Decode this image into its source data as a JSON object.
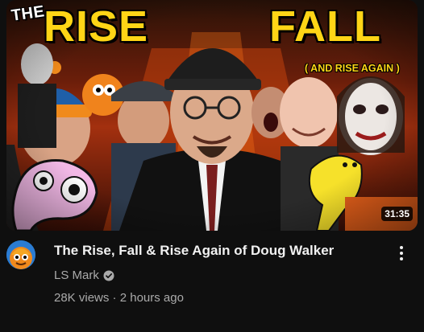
{
  "thumbnail": {
    "word_the": "THE",
    "word_rise": "RISE",
    "word_fall": "FALL",
    "word_again": "( AND RISE AGAIN )",
    "duration": "31:35"
  },
  "video": {
    "title": "The Rise, Fall & Rise Again of Doug Walker",
    "channel": "LS Mark",
    "views": "28K views",
    "separator": "·",
    "age": "2 hours ago"
  },
  "icons": {
    "verified": "verified-checkmark-icon",
    "menu": "more-vert-icon"
  },
  "colors": {
    "background": "#0f0f0f",
    "title_text": "#f1f1f1",
    "secondary_text": "#aaaaaa",
    "thumbnail_title_yellow": "#ffd516"
  }
}
